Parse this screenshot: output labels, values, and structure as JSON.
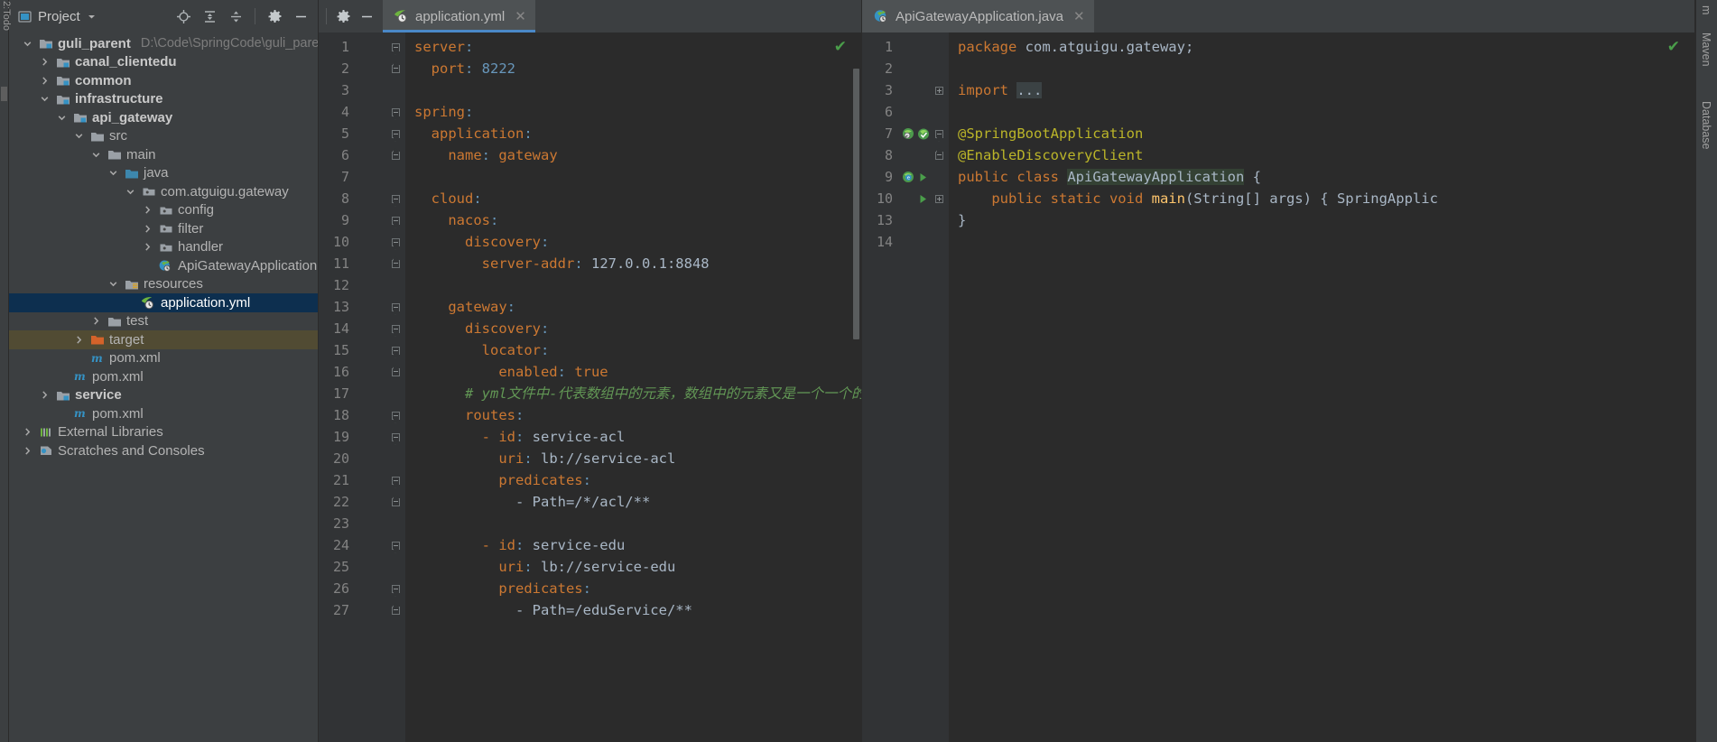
{
  "window": {
    "left_strip_label": "2:Todo",
    "right_strip_items": [
      "m",
      "Maven",
      "Database"
    ]
  },
  "project_panel": {
    "title": "Project",
    "title_icon": "project-window-icon",
    "dropdown_icon": "chevron-down-icon",
    "toolbar_icons": [
      "locate-target-icon",
      "expand-all-icon",
      "collapse-all-icon",
      "settings-gear-icon",
      "hide-panel-icon"
    ],
    "tree": [
      {
        "depth": 0,
        "arrow": "down",
        "icon": "module-icon",
        "label": "guli_parent",
        "bold": true,
        "path": "D:\\Code\\SpringCode\\guli_parent"
      },
      {
        "depth": 1,
        "arrow": "right",
        "icon": "module-icon",
        "label": "canal_clientedu",
        "bold": true
      },
      {
        "depth": 1,
        "arrow": "right",
        "icon": "module-icon",
        "label": "common",
        "bold": true
      },
      {
        "depth": 1,
        "arrow": "down",
        "icon": "module-icon",
        "label": "infrastructure",
        "bold": true
      },
      {
        "depth": 2,
        "arrow": "down",
        "icon": "module-icon",
        "label": "api_gateway",
        "bold": true
      },
      {
        "depth": 3,
        "arrow": "down",
        "icon": "folder-icon",
        "label": "src"
      },
      {
        "depth": 4,
        "arrow": "down",
        "icon": "folder-icon",
        "label": "main"
      },
      {
        "depth": 5,
        "arrow": "down",
        "icon": "source-root-icon",
        "label": "java"
      },
      {
        "depth": 6,
        "arrow": "down",
        "icon": "package-icon",
        "label": "com.atguigu.gateway"
      },
      {
        "depth": 7,
        "arrow": "right",
        "icon": "package-icon",
        "label": "config"
      },
      {
        "depth": 7,
        "arrow": "right",
        "icon": "package-icon",
        "label": "filter"
      },
      {
        "depth": 7,
        "arrow": "right",
        "icon": "package-icon",
        "label": "handler"
      },
      {
        "depth": 7,
        "arrow": "none",
        "icon": "spring-class-icon",
        "label": "ApiGatewayApplication"
      },
      {
        "depth": 5,
        "arrow": "down",
        "icon": "resource-root-icon",
        "label": "resources"
      },
      {
        "depth": 6,
        "arrow": "none",
        "icon": "spring-yaml-icon",
        "label": "application.yml",
        "selected": true
      },
      {
        "depth": 4,
        "arrow": "right",
        "icon": "folder-icon",
        "label": "test"
      },
      {
        "depth": 3,
        "arrow": "right",
        "icon": "excluded-folder-icon",
        "label": "target",
        "highlight": true
      },
      {
        "depth": 3,
        "arrow": "none",
        "icon": "maven-icon",
        "label": "pom.xml"
      },
      {
        "depth": 2,
        "arrow": "none",
        "icon": "maven-icon",
        "label": "pom.xml"
      },
      {
        "depth": 1,
        "arrow": "right",
        "icon": "module-icon",
        "label": "service",
        "bold": true
      },
      {
        "depth": 2,
        "arrow": "none",
        "icon": "maven-icon",
        "label": "pom.xml"
      },
      {
        "depth": 0,
        "arrow": "right",
        "icon": "libraries-icon",
        "label": "External Libraries"
      },
      {
        "depth": 0,
        "arrow": "right",
        "icon": "scratches-icon",
        "label": "Scratches and Consoles"
      }
    ]
  },
  "editor_left": {
    "tab": {
      "label": "application.yml",
      "icon": "spring-yaml-icon",
      "close_icon": "close-icon",
      "active": true
    },
    "inspection_status": "ok-check-icon",
    "lines": [
      {
        "n": "1",
        "fold": "down",
        "marker": "",
        "tokens": [
          {
            "t": "server",
            "c": "y-key"
          },
          {
            "t": ":",
            "c": "y-col"
          }
        ]
      },
      {
        "n": "2",
        "fold": "up",
        "marker": "",
        "tokens": [
          {
            "t": "  port",
            "c": "y-key"
          },
          {
            "t": ": ",
            "c": "y-col"
          },
          {
            "t": "8222",
            "c": "y-num"
          }
        ]
      },
      {
        "n": "3",
        "fold": "",
        "marker": "",
        "tokens": []
      },
      {
        "n": "4",
        "fold": "down",
        "marker": "",
        "tokens": [
          {
            "t": "spring",
            "c": "y-key"
          },
          {
            "t": ":",
            "c": "y-col"
          }
        ]
      },
      {
        "n": "5",
        "fold": "down",
        "marker": "",
        "tokens": [
          {
            "t": "  application",
            "c": "y-key"
          },
          {
            "t": ":",
            "c": "y-col"
          }
        ]
      },
      {
        "n": "6",
        "fold": "up",
        "marker": "",
        "tokens": [
          {
            "t": "    name",
            "c": "y-key"
          },
          {
            "t": ": ",
            "c": "y-col"
          },
          {
            "t": "gateway",
            "c": "y-key"
          }
        ]
      },
      {
        "n": "7",
        "fold": "",
        "marker": "",
        "tokens": []
      },
      {
        "n": "8",
        "fold": "down",
        "marker": "",
        "tokens": [
          {
            "t": "  cloud",
            "c": "y-key"
          },
          {
            "t": ":",
            "c": "y-col"
          }
        ]
      },
      {
        "n": "9",
        "fold": "down",
        "marker": "",
        "tokens": [
          {
            "t": "    nacos",
            "c": "y-key"
          },
          {
            "t": ":",
            "c": "y-col"
          }
        ]
      },
      {
        "n": "10",
        "fold": "down",
        "marker": "",
        "tokens": [
          {
            "t": "      discovery",
            "c": "y-key"
          },
          {
            "t": ":",
            "c": "y-col"
          }
        ]
      },
      {
        "n": "11",
        "fold": "up",
        "marker": "",
        "tokens": [
          {
            "t": "        server-addr",
            "c": "y-key"
          },
          {
            "t": ": ",
            "c": "y-col"
          },
          {
            "t": "127.0.0.1:8848",
            "c": "y-val"
          }
        ]
      },
      {
        "n": "12",
        "fold": "",
        "marker": "",
        "tokens": []
      },
      {
        "n": "13",
        "fold": "down",
        "marker": "",
        "tokens": [
          {
            "t": "    gateway",
            "c": "y-key"
          },
          {
            "t": ":",
            "c": "y-col"
          }
        ]
      },
      {
        "n": "14",
        "fold": "down",
        "marker": "",
        "tokens": [
          {
            "t": "      discovery",
            "c": "y-key"
          },
          {
            "t": ":",
            "c": "y-col"
          }
        ]
      },
      {
        "n": "15",
        "fold": "down",
        "marker": "",
        "tokens": [
          {
            "t": "        locator",
            "c": "y-key"
          },
          {
            "t": ":",
            "c": "y-col"
          }
        ]
      },
      {
        "n": "16",
        "fold": "up",
        "marker": "",
        "tokens": [
          {
            "t": "          enabled",
            "c": "y-key"
          },
          {
            "t": ": ",
            "c": "y-col"
          },
          {
            "t": "true",
            "c": "y-key"
          }
        ]
      },
      {
        "n": "17",
        "fold": "",
        "marker": "",
        "tokens": [
          {
            "t": "      # yml文件中-代表数组中的元素，数组中的元素又是一个一个的对",
            "c": "cmt"
          }
        ]
      },
      {
        "n": "18",
        "fold": "down",
        "marker": "",
        "tokens": [
          {
            "t": "      routes",
            "c": "y-key"
          },
          {
            "t": ":",
            "c": "y-col"
          }
        ]
      },
      {
        "n": "19",
        "fold": "down",
        "marker": "",
        "tokens": [
          {
            "t": "        - id",
            "c": "y-key"
          },
          {
            "t": ": ",
            "c": "y-col"
          },
          {
            "t": "service-acl",
            "c": "y-val"
          }
        ]
      },
      {
        "n": "20",
        "fold": "",
        "marker": "",
        "tokens": [
          {
            "t": "          uri",
            "c": "y-key"
          },
          {
            "t": ": ",
            "c": "y-col"
          },
          {
            "t": "lb://service-acl",
            "c": "y-val"
          }
        ]
      },
      {
        "n": "21",
        "fold": "down",
        "marker": "",
        "tokens": [
          {
            "t": "          predicates",
            "c": "y-key"
          },
          {
            "t": ":",
            "c": "y-col"
          }
        ]
      },
      {
        "n": "22",
        "fold": "up",
        "marker": "",
        "tokens": [
          {
            "t": "            - Path=/*/acl/**",
            "c": "y-val"
          }
        ]
      },
      {
        "n": "23",
        "fold": "",
        "marker": "",
        "tokens": []
      },
      {
        "n": "24",
        "fold": "down",
        "marker": "",
        "tokens": [
          {
            "t": "        - id",
            "c": "y-key"
          },
          {
            "t": ": ",
            "c": "y-col"
          },
          {
            "t": "service-edu",
            "c": "y-val"
          }
        ]
      },
      {
        "n": "25",
        "fold": "",
        "marker": "",
        "tokens": [
          {
            "t": "          uri",
            "c": "y-key"
          },
          {
            "t": ": ",
            "c": "y-col"
          },
          {
            "t": "lb://service-edu",
            "c": "y-val"
          }
        ]
      },
      {
        "n": "26",
        "fold": "down",
        "marker": "",
        "tokens": [
          {
            "t": "          predicates",
            "c": "y-key"
          },
          {
            "t": ":",
            "c": "y-col"
          }
        ]
      },
      {
        "n": "27",
        "fold": "up",
        "marker": "",
        "tokens": [
          {
            "t": "            - Path=/eduService/**",
            "c": "y-val"
          }
        ]
      }
    ]
  },
  "editor_right": {
    "tab": {
      "label": "ApiGatewayApplication.java",
      "icon": "spring-class-icon",
      "close_icon": "close-icon",
      "active": false
    },
    "inspection_status": "ok-check-icon",
    "lines": [
      {
        "n": "1",
        "fold": "",
        "marker": "",
        "tokens": [
          {
            "t": "package ",
            "c": "k-key"
          },
          {
            "t": "com.atguigu.gateway;",
            "c": "cls"
          }
        ]
      },
      {
        "n": "2",
        "fold": "",
        "marker": "",
        "tokens": []
      },
      {
        "n": "3",
        "fold": "plus",
        "marker": "",
        "tokens": [
          {
            "t": "import ",
            "c": "k-key"
          },
          {
            "t": "...",
            "c": "hl-fold"
          }
        ]
      },
      {
        "n": "6",
        "fold": "",
        "marker": "",
        "tokens": []
      },
      {
        "n": "7",
        "fold": "down",
        "marker": "bean-nav-icons",
        "tokens": [
          {
            "t": "@SpringBootApplication",
            "c": "ann"
          }
        ]
      },
      {
        "n": "8",
        "fold": "up",
        "marker": "",
        "tokens": [
          {
            "t": "@EnableDiscoveryClient",
            "c": "ann"
          }
        ]
      },
      {
        "n": "9",
        "fold": "",
        "marker": "spring-bean-run-icons",
        "tokens": [
          {
            "t": "public class ",
            "c": "k-key"
          },
          {
            "t": "ApiGatewayApplication",
            "c": "hl-usage"
          },
          {
            "t": " {",
            "c": "cls"
          }
        ]
      },
      {
        "n": "10",
        "fold": "plus",
        "marker": "run-icon",
        "tokens": [
          {
            "t": "    public static void ",
            "c": "k-key"
          },
          {
            "t": "main",
            "c": "mth"
          },
          {
            "t": "(String[] args) { SpringApplic",
            "c": "cls"
          }
        ]
      },
      {
        "n": "13",
        "fold": "",
        "marker": "",
        "tokens": [
          {
            "t": "}",
            "c": "cls"
          }
        ]
      },
      {
        "n": "14",
        "fold": "",
        "marker": "",
        "tokens": []
      }
    ]
  }
}
